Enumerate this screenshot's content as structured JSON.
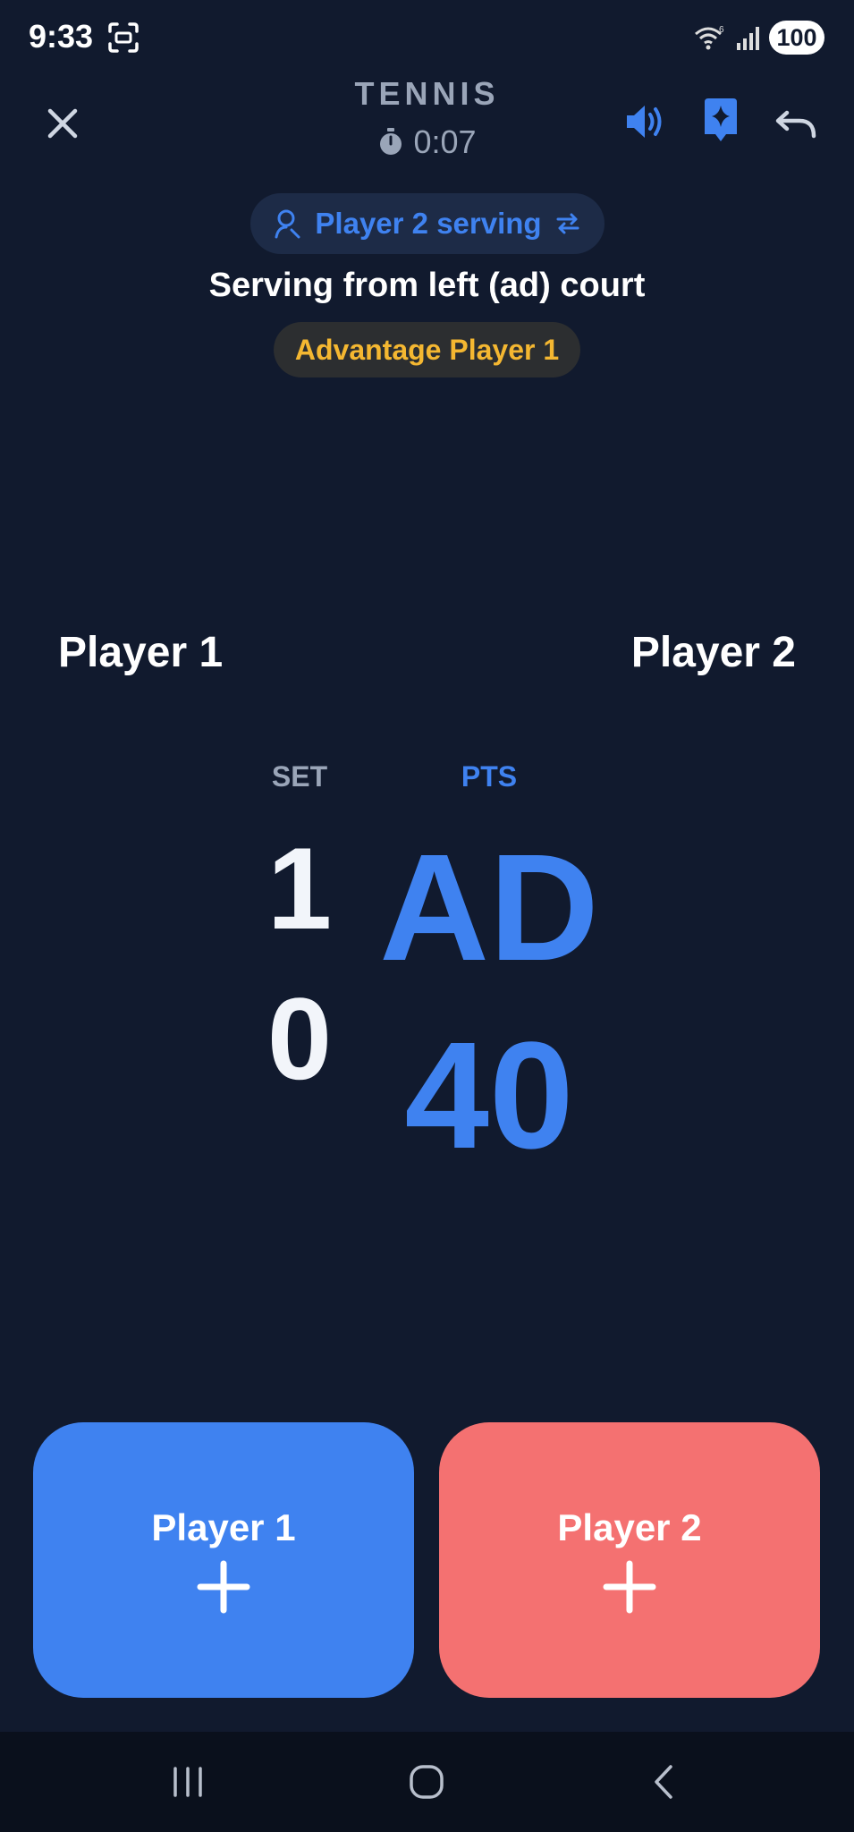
{
  "status_bar": {
    "time": "9:33",
    "battery": "100",
    "icons": [
      "screenshot-scan-icon",
      "wifi-icon",
      "signal-icon",
      "battery-icon"
    ]
  },
  "header": {
    "title": "TENNIS",
    "timer": "0:07",
    "icons": [
      "close-icon",
      "volume-icon",
      "sparkle-bookmark-icon",
      "undo-icon"
    ]
  },
  "serve": {
    "label": "Player 2 serving",
    "court": "Serving from left (ad) court",
    "advantage": "Advantage Player 1"
  },
  "players": {
    "p1": {
      "name": "Player 1",
      "set": "1",
      "pts": "AD"
    },
    "p2": {
      "name": "Player 2",
      "set": "0",
      "pts": "40"
    }
  },
  "columns": {
    "set": "SET",
    "pts": "PTS"
  },
  "buttons": {
    "p1": {
      "label": "Player 1"
    },
    "p2": {
      "label": "Player 2"
    }
  },
  "colors": {
    "background": "#111a2e",
    "accent": "#3f82f0",
    "player2": "#f47171",
    "advantage": "#f4b731",
    "muted": "#9aa5b8"
  }
}
